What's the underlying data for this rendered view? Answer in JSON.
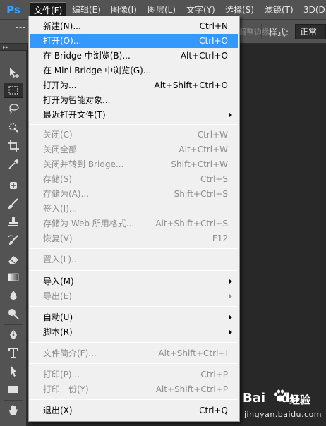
{
  "app": {
    "logo": "Ps",
    "accent": "#3ba1ff"
  },
  "menubar": {
    "items": [
      {
        "label": "文件(F)",
        "active": true
      },
      {
        "label": "编辑(E)"
      },
      {
        "label": "图像(I)"
      },
      {
        "label": "图层(L)"
      },
      {
        "label": "文字(Y)"
      },
      {
        "label": "选择(S)"
      },
      {
        "label": "滤镜(T)"
      },
      {
        "label": "3D(D)"
      }
    ]
  },
  "options": {
    "faded_label": "调整边缘",
    "style_label": "样式:",
    "style_value": "正常"
  },
  "toolbox": {
    "collapse_glyph": "▸▸",
    "tools": [
      "move",
      "rect-marquee",
      "lasso",
      "quick-select",
      "crop",
      "eyedropper",
      "spot-heal",
      "brush",
      "clone-stamp",
      "history-brush",
      "eraser",
      "gradient",
      "blur",
      "dodge",
      "pen",
      "type",
      "path-select",
      "rectangle",
      "hand"
    ]
  },
  "file_menu": {
    "highlight_color": "#3399ff",
    "items": [
      {
        "label": "新建(N)...",
        "shortcut": "Ctrl+N",
        "enabled": true
      },
      {
        "label": "打开(O)...",
        "shortcut": "Ctrl+O",
        "enabled": true,
        "highlighted": true
      },
      {
        "label": "在 Bridge 中浏览(B)...",
        "shortcut": "Alt+Ctrl+O",
        "enabled": true
      },
      {
        "label": "在 Mini Bridge 中浏览(G)...",
        "shortcut": "",
        "enabled": true
      },
      {
        "label": "打开为...",
        "shortcut": "Alt+Shift+Ctrl+O",
        "enabled": true
      },
      {
        "label": "打开为智能对象...",
        "shortcut": "",
        "enabled": true
      },
      {
        "label": "最近打开文件(T)",
        "shortcut": "",
        "enabled": true,
        "submenu": true
      },
      {
        "label": "关闭(C)",
        "shortcut": "Ctrl+W",
        "enabled": false
      },
      {
        "label": "关闭全部",
        "shortcut": "Alt+Ctrl+W",
        "enabled": false
      },
      {
        "label": "关闭并转到 Bridge...",
        "shortcut": "Shift+Ctrl+W",
        "enabled": false
      },
      {
        "label": "存储(S)",
        "shortcut": "Ctrl+S",
        "enabled": false
      },
      {
        "label": "存储为(A)...",
        "shortcut": "Shift+Ctrl+S",
        "enabled": false
      },
      {
        "label": "签入(I)...",
        "shortcut": "",
        "enabled": false
      },
      {
        "label": "存储为 Web 所用格式...",
        "shortcut": "Alt+Shift+Ctrl+S",
        "enabled": false
      },
      {
        "label": "恢复(V)",
        "shortcut": "F12",
        "enabled": false
      },
      {
        "label": "置入(L)...",
        "shortcut": "",
        "enabled": false
      },
      {
        "label": "导入(M)",
        "shortcut": "",
        "enabled": true,
        "submenu": true
      },
      {
        "label": "导出(E)",
        "shortcut": "",
        "enabled": false,
        "submenu": true
      },
      {
        "label": "自动(U)",
        "shortcut": "",
        "enabled": true,
        "submenu": true
      },
      {
        "label": "脚本(R)",
        "shortcut": "",
        "enabled": true,
        "submenu": true
      },
      {
        "label": "文件简介(F)...",
        "shortcut": "Alt+Shift+Ctrl+I",
        "enabled": false
      },
      {
        "label": "打印(P)...",
        "shortcut": "Ctrl+P",
        "enabled": false
      },
      {
        "label": "打印一份(Y)",
        "shortcut": "Alt+Shift+Ctrl+P",
        "enabled": false
      },
      {
        "label": "退出(X)",
        "shortcut": "Ctrl+Q",
        "enabled": true
      }
    ]
  },
  "watermark": {
    "brand": "Bai",
    "brand_tail": "du",
    "product": "经验",
    "url": "jingyan.baidu.com"
  }
}
